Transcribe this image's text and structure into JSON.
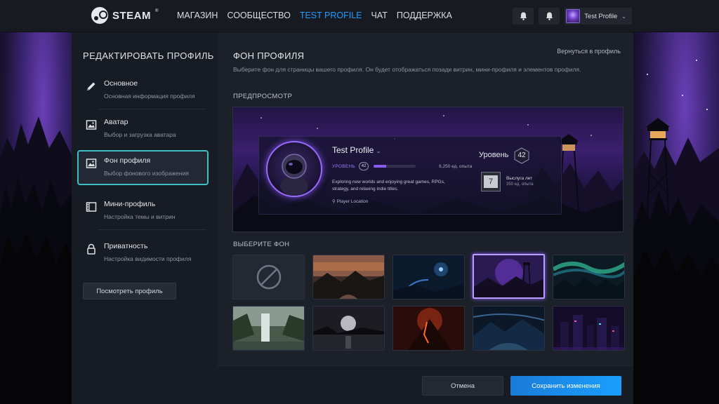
{
  "app": {
    "name": "STEAM"
  },
  "nav": {
    "items": [
      "МАГАЗИН",
      "СООБЩЕСТВО",
      "TEST PROFILE",
      "ЧАТ",
      "ПОДДЕРЖКА"
    ],
    "active_index": 2
  },
  "user": {
    "name": "Test Profile"
  },
  "sidebar": {
    "title": "РЕДАКТИРОВАТЬ ПРОФИЛЬ",
    "items": [
      {
        "title": "Основное",
        "sub": "Основная информация профиля",
        "icon": "pencil-icon"
      },
      {
        "title": "Аватар",
        "sub": "Выбор и загрузка аватара",
        "icon": "image-icon"
      },
      {
        "title": "Фон профиля",
        "sub": "Выбор фонового изображения",
        "icon": "image-icon"
      },
      {
        "title": "Мини-профиль",
        "sub": "Настройка темы и витрин",
        "icon": "film-icon"
      },
      {
        "title": "Приватность",
        "sub": "Настройка видимости профиля",
        "icon": "lock-icon"
      }
    ],
    "selected_index": 2,
    "view_profile_label": "Посмотреть профиль"
  },
  "content": {
    "title": "ФОН ПРОФИЛЯ",
    "description": "Выберите фон для страницы вашего профиля. Он будет отображаться позади витрин, мини-профиля и элементов профиля.",
    "back_link": "Вернуться в профиль",
    "preview_label": "ПРЕДПРОСМОТР",
    "choose_label": "ВЫБЕРИТЕ ФОН"
  },
  "preview": {
    "name": "Test Profile",
    "level_label": "УРОВЕНЬ",
    "level": "42",
    "xp_text": "6,250 ед. опыта",
    "xp_fraction": 0.3,
    "bio": "Exploring new worlds and enjoying great games, RPGs, strategy, and relaxing indie titles.",
    "location": "Player Location",
    "rank_label": "Уровень",
    "rank_value": "42",
    "badge_value": "7",
    "badge_title": "Выслуга лет",
    "badge_sub": "350 ед. опыта"
  },
  "thumbnails": {
    "selected_index": 3,
    "items": [
      "none",
      "sunset-forest",
      "blue-planet",
      "purple-tower",
      "aurora",
      "waterfall",
      "moon-lake",
      "volcano",
      "blue-mountains",
      "neon-city"
    ]
  },
  "footer": {
    "cancel_label": "Отмена",
    "save_label": "Сохранить изменения"
  },
  "colors": {
    "accent": "#1a9fff",
    "selection": "#3fbfc4",
    "purple": "#8a5cff"
  }
}
